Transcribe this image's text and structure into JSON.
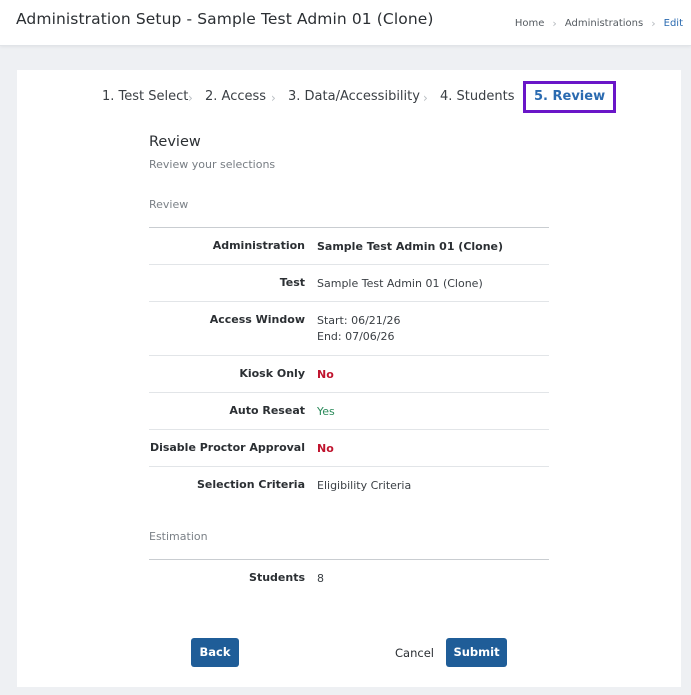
{
  "header": {
    "title": "Administration Setup - Sample Test Admin 01 (Clone)",
    "breadcrumb": [
      "Home",
      "Administrations",
      "Edit"
    ]
  },
  "steps": [
    {
      "label": "1. Test Select",
      "active": false
    },
    {
      "label": "2. Access",
      "active": false
    },
    {
      "label": "3. Data/Accessibility",
      "active": false
    },
    {
      "label": "4. Students",
      "active": false
    },
    {
      "label": "5. Review",
      "active": true
    }
  ],
  "colors": {
    "accent": "#1f5d98",
    "active_step_outline": "#6a16c8",
    "no": "#c0142e",
    "yes": "#2a8a5a"
  },
  "review": {
    "heading": "Review",
    "subheading": "Review your selections",
    "section_label": "Review",
    "rows": [
      {
        "label": "Administration",
        "value": "Sample Test Admin 01 (Clone)"
      },
      {
        "label": "Test",
        "value": "Sample Test Admin 01 (Clone)"
      },
      {
        "label": "Access Window",
        "value_line1": "Start: 06/21/26",
        "value_line2": "End: 07/06/26"
      },
      {
        "label": "Kiosk Only",
        "value": "No"
      },
      {
        "label": "Auto Reseat",
        "value": "Yes"
      },
      {
        "label": "Disable Proctor Approval",
        "value": "No"
      },
      {
        "label": "Selection Criteria",
        "value": "Eligibility Criteria"
      }
    ]
  },
  "estimation": {
    "section_label": "Estimation",
    "rows": [
      {
        "label": "Students",
        "value": "8"
      }
    ]
  },
  "actions": {
    "back": "Back",
    "cancel": "Cancel",
    "submit": "Submit"
  }
}
